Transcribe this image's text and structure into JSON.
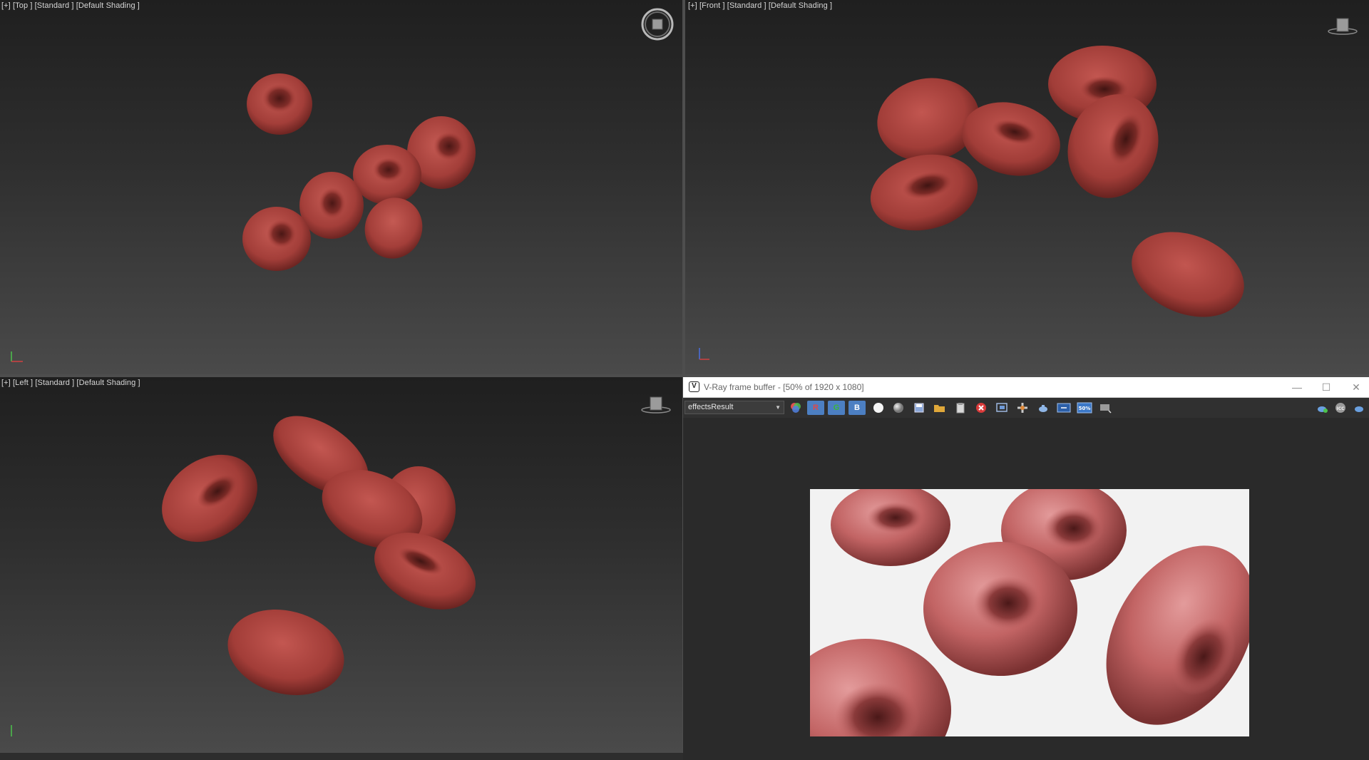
{
  "viewports": {
    "top": {
      "label": "[+] [Top ] [Standard ] [Default Shading ]"
    },
    "front": {
      "label": "[+] [Front ] [Standard ] [Default Shading ]"
    },
    "left": {
      "label": "[+] [Left ] [Standard ] [Default Shading ]"
    }
  },
  "vfb": {
    "logo": "V",
    "title": "V-Ray frame buffer - [50% of 1920 x 1080]",
    "window_controls": {
      "minimize": "—",
      "maximize": "☐",
      "close": "✕"
    },
    "channel": "effectsResult",
    "toolbar": {
      "r": "R",
      "g": "G",
      "b": "B",
      "zoom": "50%"
    }
  },
  "colors": {
    "cell_red": "#b5453f",
    "cell_dark": "#7a2a26",
    "render_bg": "#f2f2f2",
    "render_cell": "#c8696a",
    "channel_blue": "#4c7fc2"
  }
}
